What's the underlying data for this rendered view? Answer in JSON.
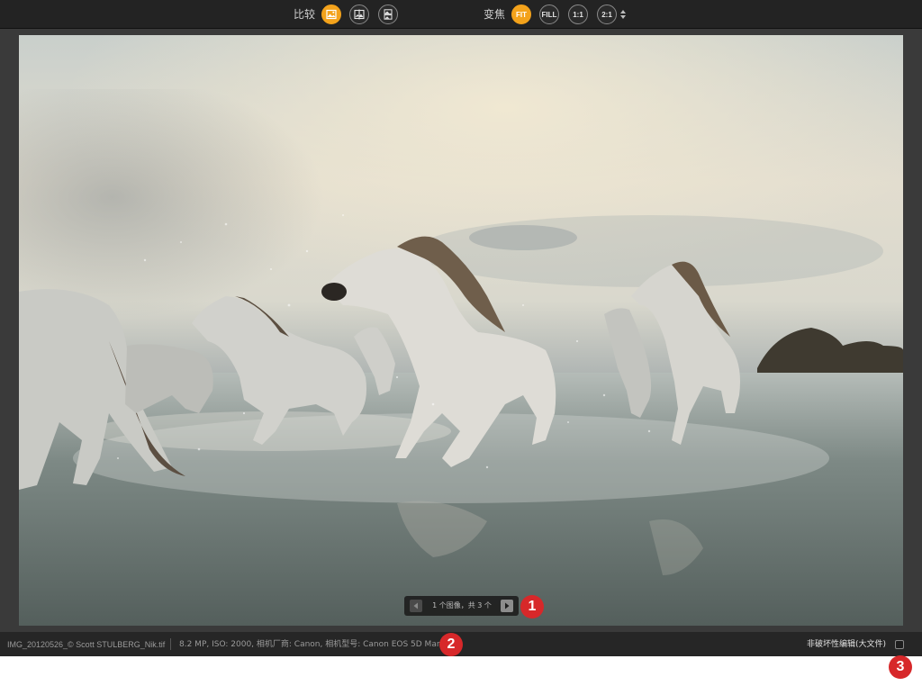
{
  "toolbar": {
    "compare_label": "比较",
    "zoom_label": "变焦",
    "compare_buttons": [
      {
        "icon": "single-view-icon",
        "active": true
      },
      {
        "icon": "split-view-icon",
        "active": false
      },
      {
        "icon": "side-by-side-icon",
        "active": false
      }
    ],
    "zoom_buttons": [
      {
        "label": "FIT",
        "active": true
      },
      {
        "label": "FILL",
        "active": false
      },
      {
        "label": "1:1",
        "active": false
      },
      {
        "label": "2:1",
        "active": false
      }
    ],
    "accent_color": "#f3a21b"
  },
  "navigator": {
    "text": "1 个图像，共 3 个",
    "prev_icon": "chevron-left-icon",
    "next_icon": "chevron-right-icon"
  },
  "status": {
    "filename": "IMG_20120526_© Scott STULBERG_Nik.tif",
    "metadata": "8.2 MP, ISO: 2000, 相机厂商: Canon, 相机型号: Canon EOS 5D Mark IV",
    "nondestructive_label": "非破坏性编辑(大文件)",
    "nondestructive_checked": false
  },
  "callouts": [
    "1",
    "2",
    "3"
  ],
  "callout_color": "#d7282a"
}
